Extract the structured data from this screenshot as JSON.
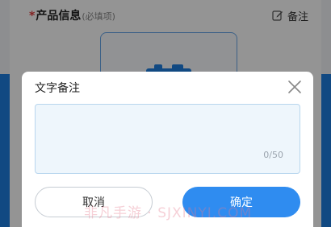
{
  "section": {
    "required_mark": "*",
    "title": "产品信息",
    "hint": "(必填项)",
    "note_label": "备注"
  },
  "dialog": {
    "title": "文字备注",
    "textarea_value": "",
    "counter": "0/50",
    "cancel_label": "取消",
    "confirm_label": "确定"
  },
  "watermark": "非凡手游 · SJXINYI.COM",
  "icons": [
    "edit-icon",
    "camera-icon",
    "close-icon"
  ],
  "colors": {
    "brand_blue": "#1E7FE0",
    "confirm_button": "#2F8CF0",
    "required_star": "#E03A3A",
    "textarea_bg": "#EEF6FC"
  }
}
